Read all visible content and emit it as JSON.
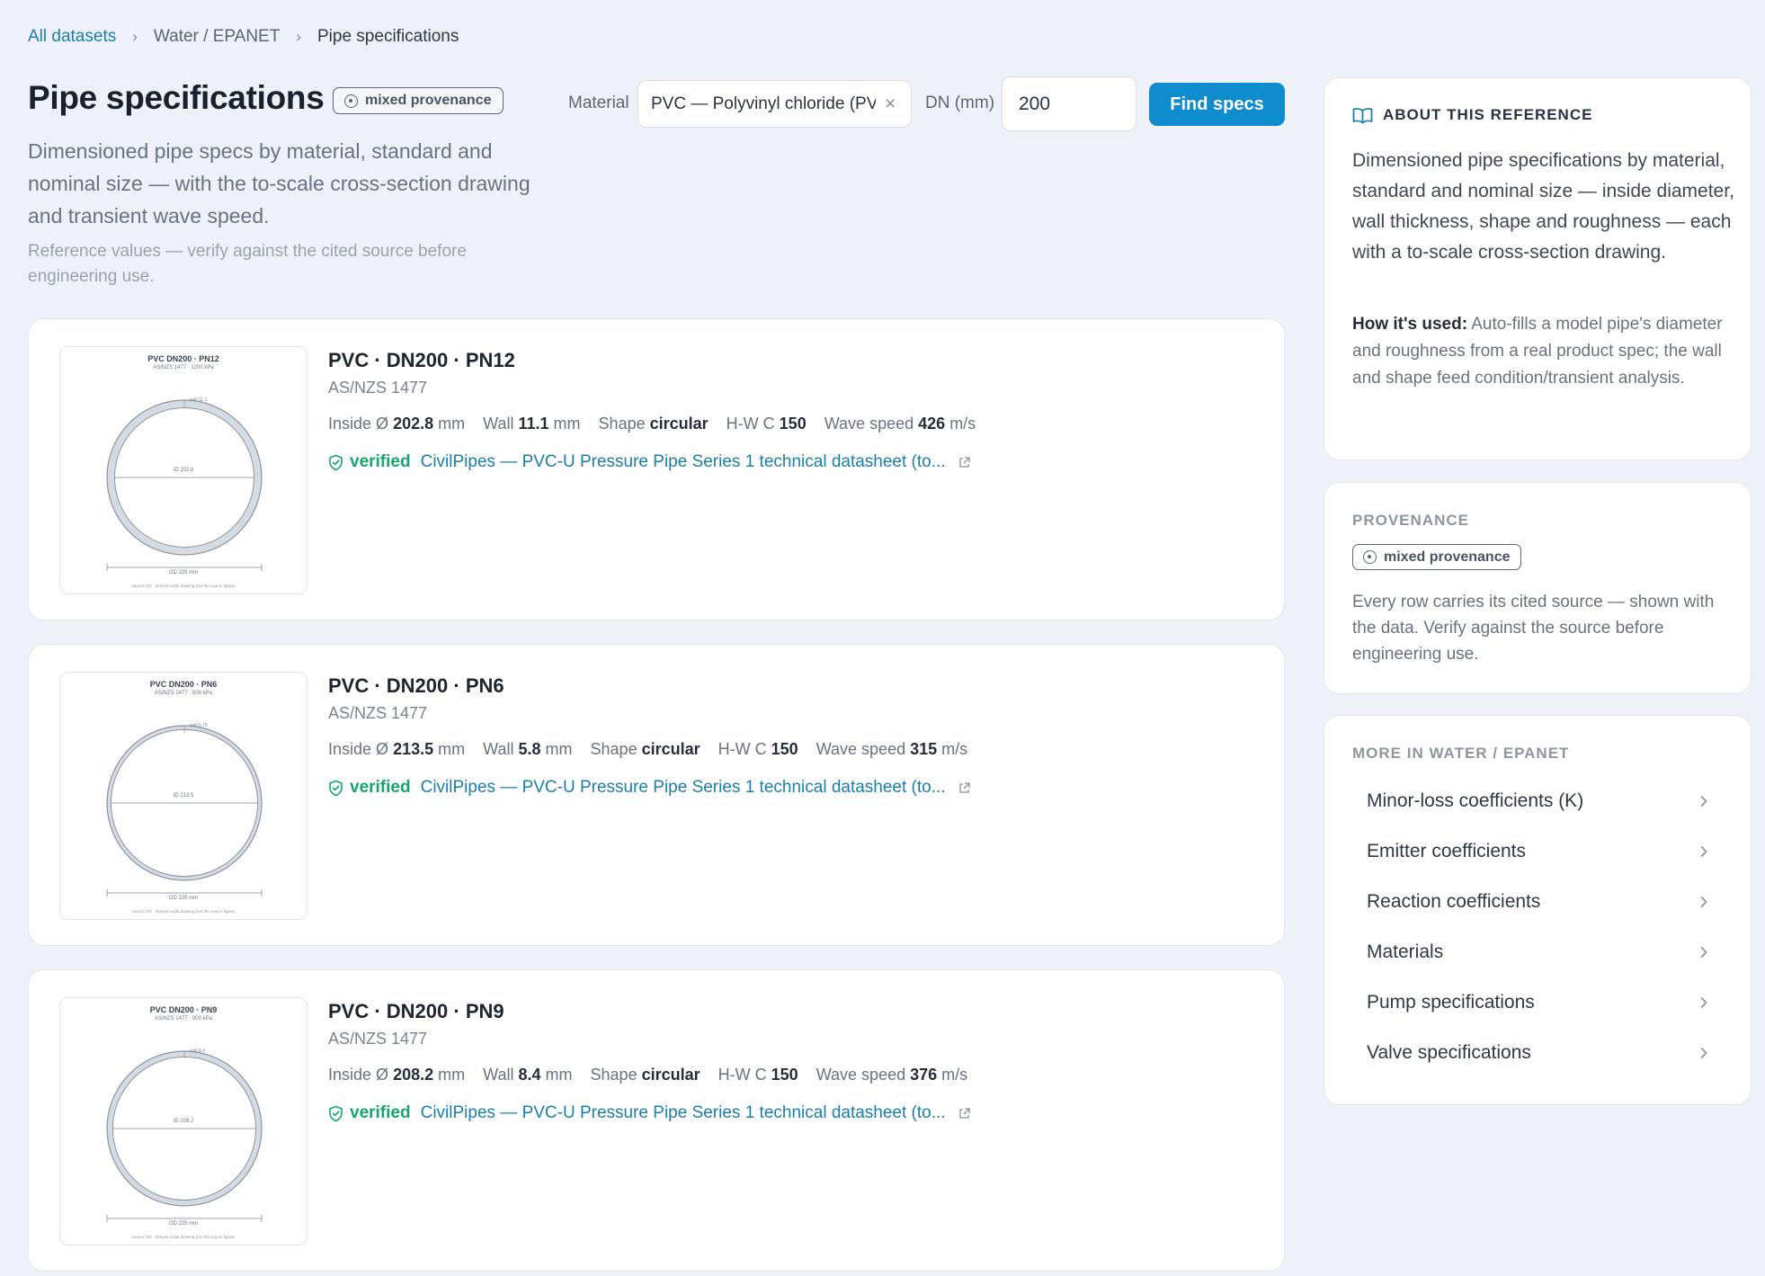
{
  "breadcrumb": {
    "root": "All datasets",
    "parent": "Water / EPANET",
    "current": "Pipe specifications"
  },
  "header": {
    "title": "Pipe specifications",
    "badge": "mixed provenance",
    "description": "Dimensioned pipe specs by material, standard and nominal size — with the to-scale cross-section drawing and transient wave speed.",
    "note": "Reference values — verify against the cited source before engineering use."
  },
  "search": {
    "material_label": "Material",
    "material_value": "PVC — Polyvinyl chloride (PVC-U)",
    "dn_label": "DN (mm)",
    "dn_value": "200",
    "find_label": "Find specs"
  },
  "spec_labels": {
    "inside": "Inside Ø",
    "wall": "Wall",
    "shape": "Shape",
    "hw": "H-W C",
    "wave": "Wave speed",
    "unit_mm": "mm",
    "unit_ms": "m/s",
    "verified": "verified"
  },
  "specs": [
    {
      "title": "PVC · DN200 · PN12",
      "standard": "AS/NZS 1477",
      "inside": "202.8",
      "wall": "11.1",
      "shape": "circular",
      "hw": "150",
      "wave": "426",
      "source": "CivilPipes — PVC-U Pressure Pipe Series 1 technical datasheet (to...",
      "drawing": {
        "title": "PVC DN200 · PN12",
        "subtitle": "AS/NZS 1477 · 1200 kPa",
        "wall_label": "wall 11.1",
        "id_label": "ID 202.8",
        "od_label": "OD 225 mm",
        "source_note": "source #33 · derived scale drawing (not the source figure)",
        "od_mm": 225,
        "id_mm": 202.8
      }
    },
    {
      "title": "PVC · DN200 · PN6",
      "standard": "AS/NZS 1477",
      "inside": "213.5",
      "wall": "5.8",
      "shape": "circular",
      "hw": "150",
      "wave": "315",
      "source": "CivilPipes — PVC-U Pressure Pipe Series 1 technical datasheet (to...",
      "drawing": {
        "title": "PVC DN200 · PN6",
        "subtitle": "AS/NZS 1477 · 600 kPa",
        "wall_label": "wall 5.75",
        "id_label": "ID 213.5",
        "od_label": "OD 225 mm",
        "source_note": "source #33 · derived scale drawing (not the source figure)",
        "od_mm": 225,
        "id_mm": 213.5
      }
    },
    {
      "title": "PVC · DN200 · PN9",
      "standard": "AS/NZS 1477",
      "inside": "208.2",
      "wall": "8.4",
      "shape": "circular",
      "hw": "150",
      "wave": "376",
      "source": "CivilPipes — PVC-U Pressure Pipe Series 1 technical datasheet (to...",
      "drawing": {
        "title": "PVC DN200 · PN9",
        "subtitle": "AS/NZS 1477 · 900 kPa",
        "wall_label": "wall 8.4",
        "id_label": "ID 208.2",
        "od_label": "OD 225 mm",
        "source_note": "source #33 · derived scale drawing (not the source figure)",
        "od_mm": 225,
        "id_mm": 208.2
      }
    }
  ],
  "about": {
    "heading": "About this reference",
    "text": "Dimensioned pipe specifications by material, standard and nominal size — inside diameter, wall thickness, shape and roughness — each with a to-scale cross-section drawing.",
    "used_label": "How it's used:",
    "used_text": " Auto-fills a model pipe's diameter and roughness from a real product spec; the wall and shape feed condition/transient analysis."
  },
  "provenance": {
    "heading": "Provenance",
    "badge": "mixed provenance",
    "text": "Every row carries its cited source — shown with the data. Verify against the source before engineering use."
  },
  "more": {
    "heading": "More in Water / EPANET",
    "items": [
      "Minor-loss coefficients (K)",
      "Emitter coefficients",
      "Reaction coefficients",
      "Materials",
      "Pump specifications",
      "Valve specifications"
    ]
  },
  "colors": {
    "accent": "#0f8ccd",
    "link": "#1b7fab",
    "verified": "#16a56c",
    "pipe_wall": "#d5dbe2"
  }
}
